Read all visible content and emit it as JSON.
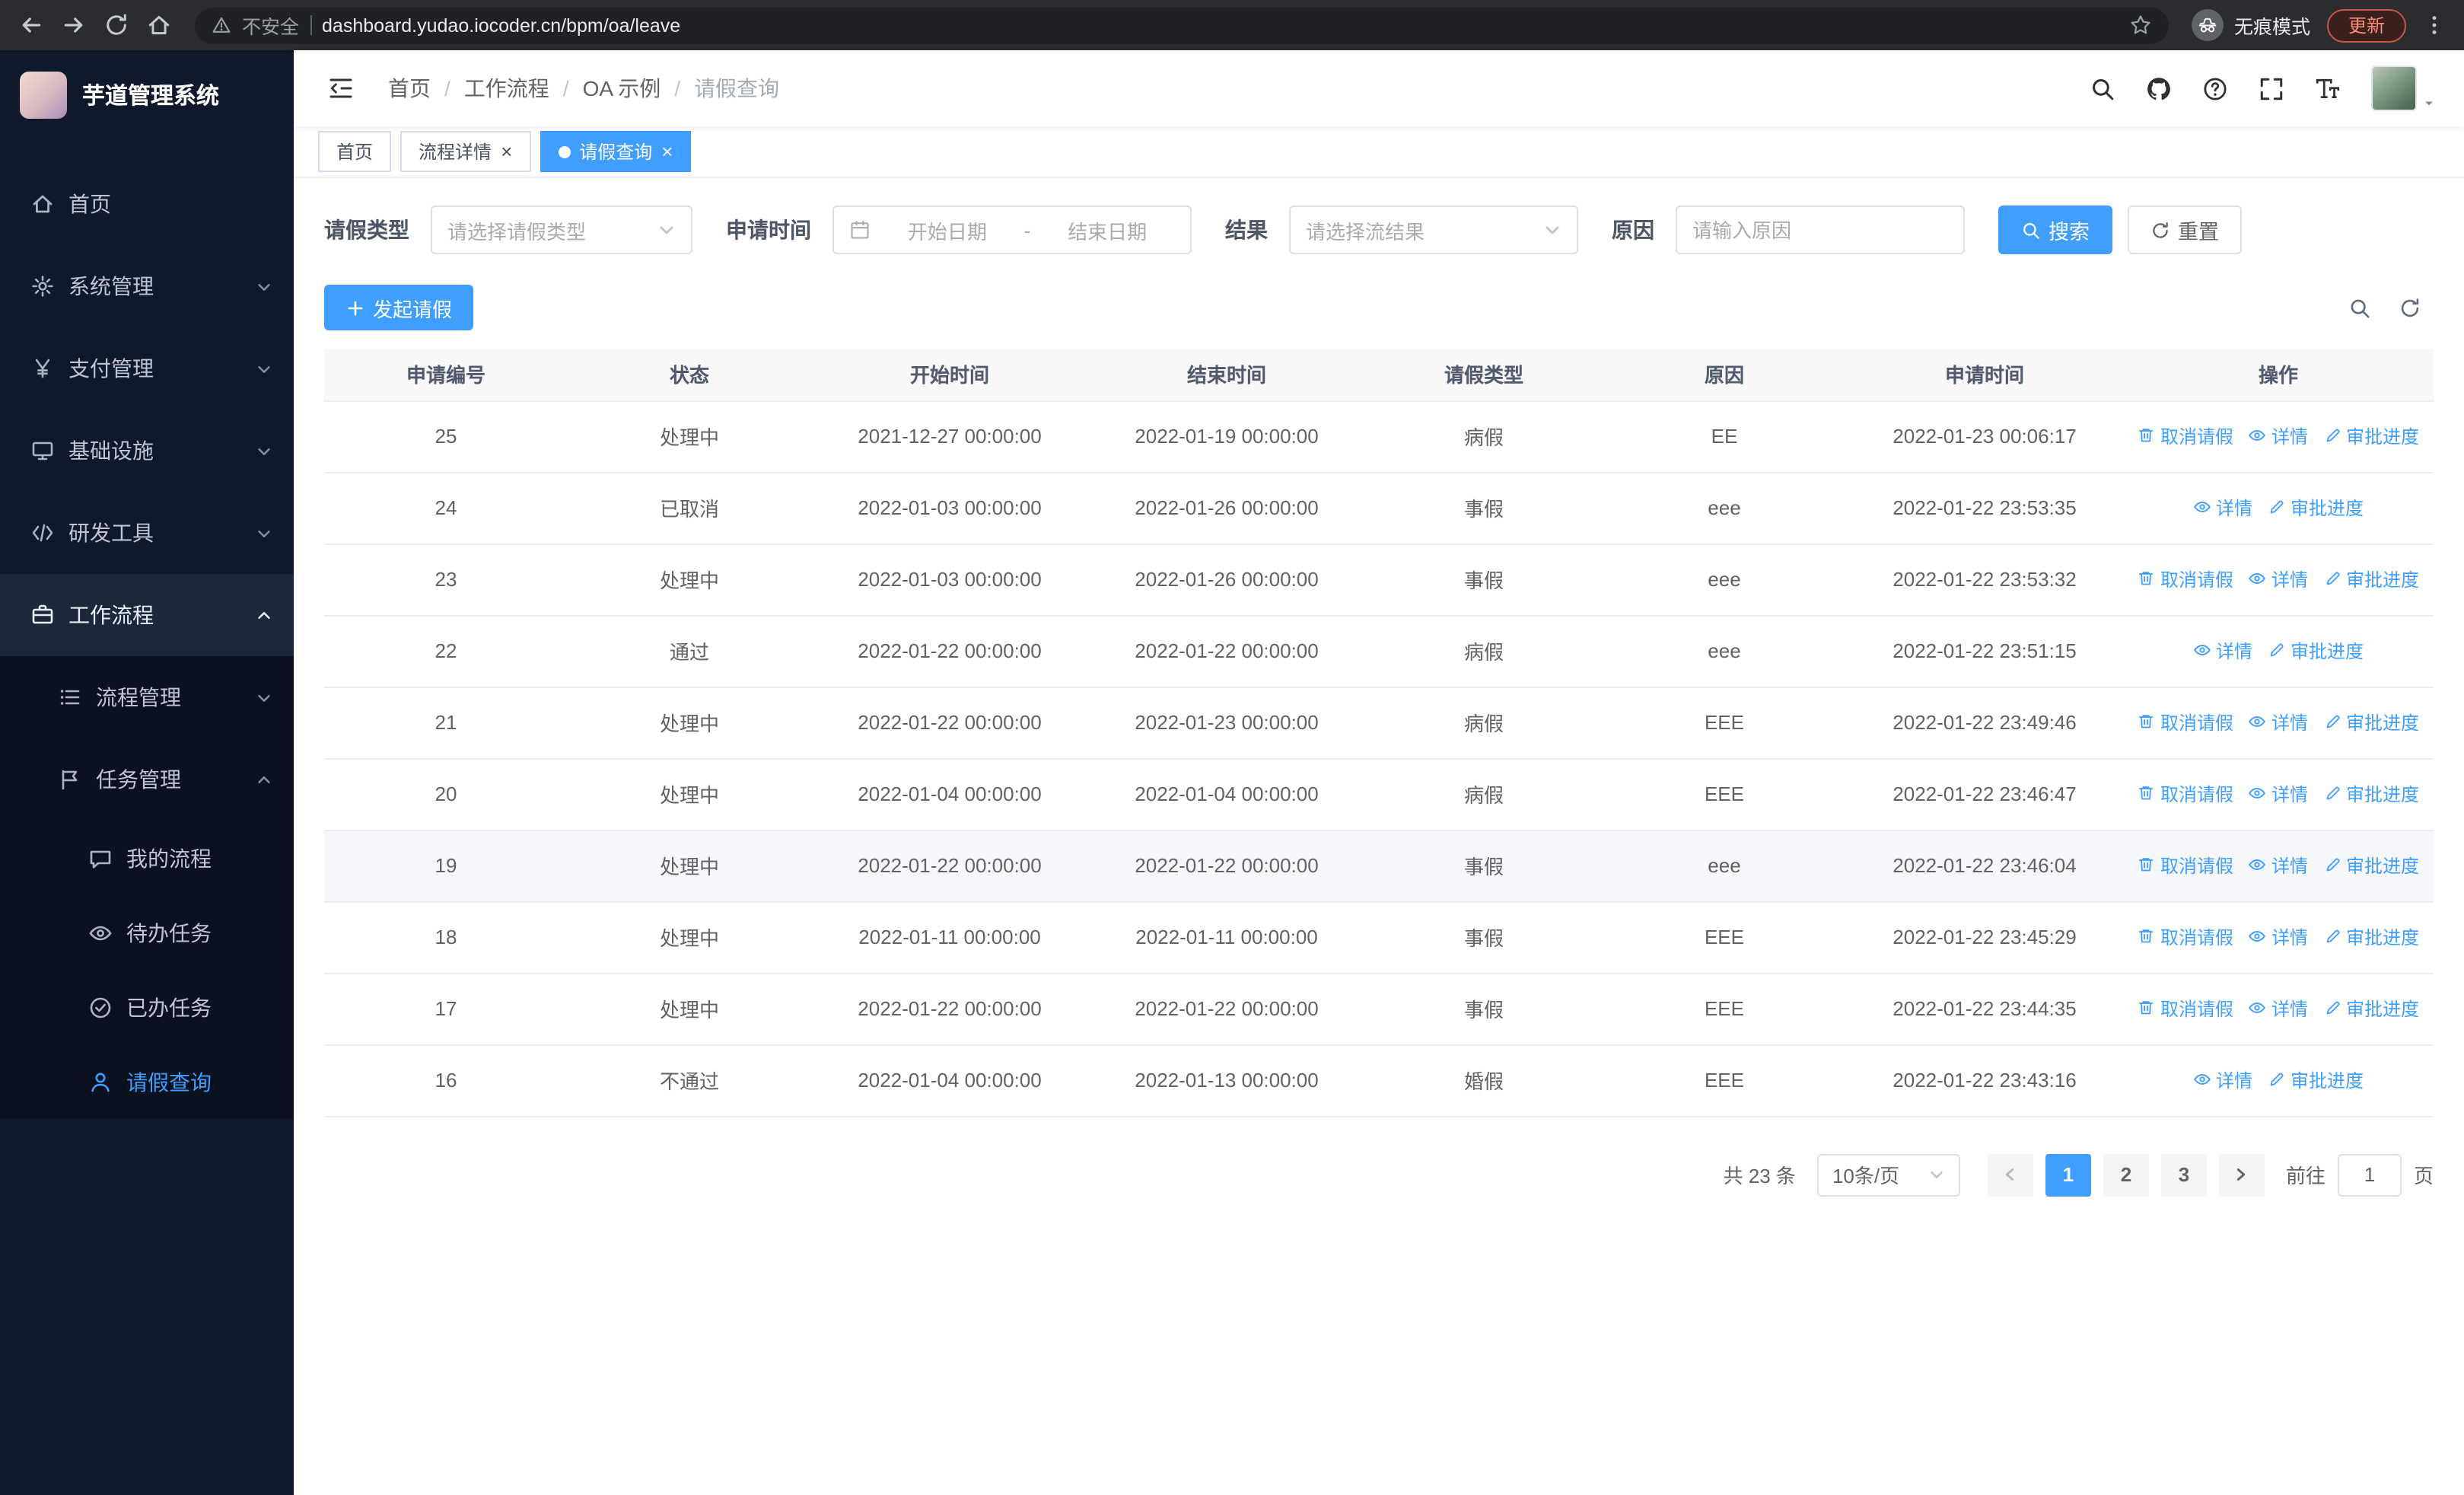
{
  "browser": {
    "security_label": "不安全",
    "url": "dashboard.yudao.iocoder.cn/bpm/oa/leave",
    "incognito_label": "无痕模式",
    "update_label": "更新"
  },
  "sidebar": {
    "app_title": "芋道管理系统",
    "menu": [
      {
        "name": "home",
        "label": "首页",
        "icon": "home",
        "level": 1
      },
      {
        "name": "system-management",
        "label": "系统管理",
        "icon": "gear",
        "level": 1,
        "chevron": "down"
      },
      {
        "name": "payment-management",
        "label": "支付管理",
        "icon": "yen",
        "level": 1,
        "chevron": "down"
      },
      {
        "name": "infrastructure",
        "label": "基础设施",
        "icon": "infra",
        "level": 1,
        "chevron": "down"
      },
      {
        "name": "dev-tools",
        "label": "研发工具",
        "icon": "devtools",
        "level": 1,
        "chevron": "down"
      },
      {
        "name": "workflow",
        "label": "工作流程",
        "icon": "workflow",
        "level": 1,
        "chevron": "up",
        "highlight": true
      },
      {
        "name": "process-management",
        "label": "流程管理",
        "icon": "process",
        "level": 2,
        "chevron": "down"
      },
      {
        "name": "task-management",
        "label": "任务管理",
        "icon": "tasks",
        "level": 2,
        "chevron": "up"
      },
      {
        "name": "my-process",
        "label": "我的流程",
        "icon": "chat",
        "level": 3
      },
      {
        "name": "todo-tasks",
        "label": "待办任务",
        "icon": "eye",
        "level": 3
      },
      {
        "name": "done-tasks",
        "label": "已办任务",
        "icon": "check",
        "level": 3
      },
      {
        "name": "leave-query",
        "label": "请假查询",
        "icon": "user",
        "level": 3,
        "active": true
      }
    ]
  },
  "header": {
    "breadcrumb": [
      "首页",
      "工作流程",
      "OA 示例",
      "请假查询"
    ]
  },
  "tabs": [
    {
      "name": "home",
      "label": "首页",
      "closable": false,
      "active": false
    },
    {
      "name": "process-detail",
      "label": "流程详情",
      "closable": true,
      "active": false
    },
    {
      "name": "leave-query",
      "label": "请假查询",
      "closable": true,
      "active": true
    }
  ],
  "filters": {
    "leave_type_label": "请假类型",
    "leave_type_placeholder": "请选择请假类型",
    "apply_time_label": "申请时间",
    "start_date_placeholder": "开始日期",
    "range_separator": "-",
    "end_date_placeholder": "结束日期",
    "result_label": "结果",
    "result_placeholder": "请选择流结果",
    "reason_label": "原因",
    "reason_placeholder": "请输入原因",
    "search_label": "搜索",
    "reset_label": "重置"
  },
  "toolbar": {
    "create_label": "发起请假"
  },
  "table": {
    "columns": [
      "申请编号",
      "状态",
      "开始时间",
      "结束时间",
      "请假类型",
      "原因",
      "申请时间",
      "操作"
    ],
    "action_labels": {
      "cancel": "取消请假",
      "detail": "详情",
      "progress": "审批进度"
    },
    "rows": [
      {
        "id": "25",
        "status": "处理中",
        "start_time": "2021-12-27 00:00:00",
        "end_time": "2022-01-19 00:00:00",
        "leave_type": "病假",
        "reason": "EE",
        "apply_time": "2022-01-23 00:06:17",
        "actions": [
          "cancel",
          "detail",
          "progress"
        ]
      },
      {
        "id": "24",
        "status": "已取消",
        "start_time": "2022-01-03 00:00:00",
        "end_time": "2022-01-26 00:00:00",
        "leave_type": "事假",
        "reason": "eee",
        "apply_time": "2022-01-22 23:53:35",
        "actions": [
          "detail",
          "progress"
        ]
      },
      {
        "id": "23",
        "status": "处理中",
        "start_time": "2022-01-03 00:00:00",
        "end_time": "2022-01-26 00:00:00",
        "leave_type": "事假",
        "reason": "eee",
        "apply_time": "2022-01-22 23:53:32",
        "actions": [
          "cancel",
          "detail",
          "progress"
        ]
      },
      {
        "id": "22",
        "status": "通过",
        "start_time": "2022-01-22 00:00:00",
        "end_time": "2022-01-22 00:00:00",
        "leave_type": "病假",
        "reason": "eee",
        "apply_time": "2022-01-22 23:51:15",
        "actions": [
          "detail",
          "progress"
        ]
      },
      {
        "id": "21",
        "status": "处理中",
        "start_time": "2022-01-22 00:00:00",
        "end_time": "2022-01-23 00:00:00",
        "leave_type": "病假",
        "reason": "EEE",
        "apply_time": "2022-01-22 23:49:46",
        "actions": [
          "cancel",
          "detail",
          "progress"
        ]
      },
      {
        "id": "20",
        "status": "处理中",
        "start_time": "2022-01-04 00:00:00",
        "end_time": "2022-01-04 00:00:00",
        "leave_type": "病假",
        "reason": "EEE",
        "apply_time": "2022-01-22 23:46:47",
        "actions": [
          "cancel",
          "detail",
          "progress"
        ]
      },
      {
        "id": "19",
        "status": "处理中",
        "start_time": "2022-01-22 00:00:00",
        "end_time": "2022-01-22 00:00:00",
        "leave_type": "事假",
        "reason": "eee",
        "apply_time": "2022-01-22 23:46:04",
        "actions": [
          "cancel",
          "detail",
          "progress"
        ],
        "highlighted": true
      },
      {
        "id": "18",
        "status": "处理中",
        "start_time": "2022-01-11 00:00:00",
        "end_time": "2022-01-11 00:00:00",
        "leave_type": "事假",
        "reason": "EEE",
        "apply_time": "2022-01-22 23:45:29",
        "actions": [
          "cancel",
          "detail",
          "progress"
        ]
      },
      {
        "id": "17",
        "status": "处理中",
        "start_time": "2022-01-22 00:00:00",
        "end_time": "2022-01-22 00:00:00",
        "leave_type": "事假",
        "reason": "EEE",
        "apply_time": "2022-01-22 23:44:35",
        "actions": [
          "cancel",
          "detail",
          "progress"
        ]
      },
      {
        "id": "16",
        "status": "不通过",
        "start_time": "2022-01-04 00:00:00",
        "end_time": "2022-01-13 00:00:00",
        "leave_type": "婚假",
        "reason": "EEE",
        "apply_time": "2022-01-22 23:43:16",
        "actions": [
          "detail",
          "progress"
        ]
      }
    ]
  },
  "pagination": {
    "total_label": "共 23 条",
    "page_size_label": "10条/页",
    "pages": [
      "1",
      "2",
      "3"
    ],
    "active_page": "1",
    "goto_label": "前往",
    "goto_value": "1",
    "unit_label": "页"
  },
  "colors": {
    "primary": "#409eff",
    "sidebar_bg": "#10192b",
    "active_text": "#409eff"
  }
}
